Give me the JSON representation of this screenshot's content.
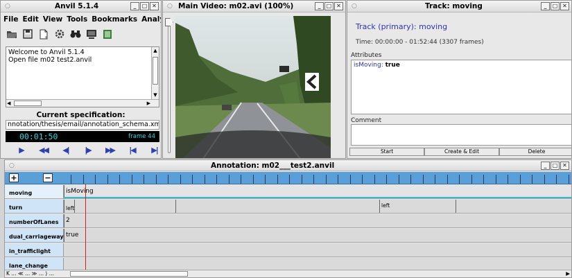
{
  "main_window": {
    "title": "Anvil 5.1.4",
    "menu": [
      "File",
      "Edit",
      "View",
      "Tools",
      "Bookmarks",
      "Analysis",
      "?"
    ],
    "toolbar_icons": [
      "open-folder-icon",
      "save-icon",
      "new-document-icon",
      "gear-icon",
      "binoculars-icon",
      "monitor-icon",
      "video-file-icon"
    ],
    "console_lines": [
      "Welcome to Anvil 5.1.4",
      "Open file m02    test2.anvil"
    ],
    "spec_title": "Current specification:",
    "spec_path": "nnotation/thesis/email/annotation_schema.xml",
    "time": "00:01:50",
    "frame": "frame 44",
    "transport": [
      {
        "name": "play-button",
        "glyph": "▶"
      },
      {
        "name": "fast-back-button",
        "glyph": "◀◀"
      },
      {
        "name": "step-back-button",
        "glyph": "◀|"
      },
      {
        "name": "step-forward-button",
        "glyph": "|▶"
      },
      {
        "name": "fast-forward-button",
        "glyph": "▶▶"
      },
      {
        "name": "go-start-button",
        "glyph": "|◀"
      },
      {
        "name": "go-end-button",
        "glyph": "▶|"
      }
    ]
  },
  "video_window": {
    "title": "Main Video: m02.avi (100%)"
  },
  "track_window": {
    "title": "Track: moving",
    "heading": "Track (primary): moving",
    "time_info": "Time: 00:00:00 - 01:52:44 (3307 frames)",
    "attributes_label": "Attributes",
    "attribute_key": "isMoving:",
    "attribute_value": "true",
    "comment_label": "Comment",
    "buttons": [
      "Start",
      "Create & Edit",
      "Delete"
    ]
  },
  "annotation_window": {
    "title": "Annotation: m02___test2.anvil",
    "plus": "+",
    "minus": "−",
    "tracks": [
      {
        "name": "moving",
        "segments": [
          {
            "label": "isMoving",
            "start": 0,
            "highlight": true
          }
        ]
      },
      {
        "name": "turn",
        "segments": [
          {
            "label": "left",
            "start": 0
          },
          {
            "label": "",
            "start": 0.02
          },
          {
            "label": "",
            "start": 0.22
          },
          {
            "label": "left",
            "start": 0.62
          },
          {
            "label": "",
            "start": 0.77
          }
        ]
      },
      {
        "name": "numberOfLanes",
        "segments": [
          {
            "label": "2",
            "start": 0
          }
        ]
      },
      {
        "name": "dual_carriageway",
        "segments": [
          {
            "label": "true",
            "start": 0
          }
        ]
      },
      {
        "name": "in_trafficlight",
        "segments": []
      },
      {
        "name": "lane_change",
        "segments": []
      }
    ],
    "nav_buttons": "K ... ≪ ... ≫ ... ⟩ ..."
  },
  "colors": {
    "timeline_header": "#5a9fd8",
    "time_display_text": "#25d8e0",
    "track_heading": "#2c33b5",
    "cursor": "#c22222",
    "highlight_underline": "#33bcd0"
  }
}
